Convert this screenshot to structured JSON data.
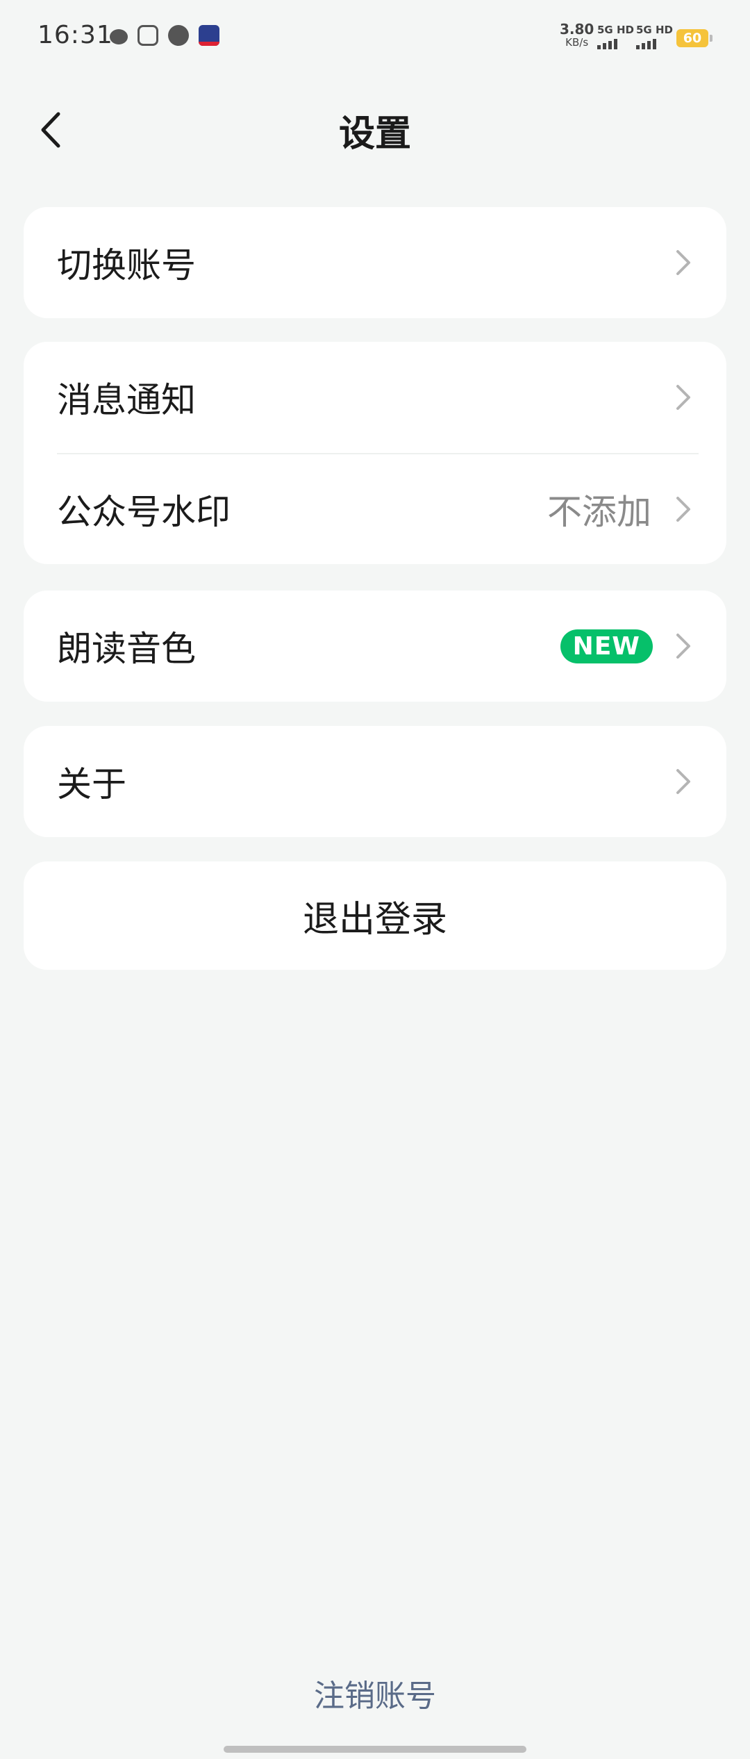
{
  "status_bar": {
    "time": "16:31",
    "net_speed_value": "3.80",
    "net_speed_unit": "KB/s",
    "sim1": "5G HD",
    "sim2": "5G HD",
    "battery": "60",
    "icons": [
      "wechat-icon",
      "scan-app-icon",
      "message-bubble-icon",
      "app-icon"
    ]
  },
  "header": {
    "title": "设置"
  },
  "groups": [
    {
      "items": [
        {
          "label": "切换账号"
        }
      ]
    },
    {
      "items": [
        {
          "label": "消息通知"
        },
        {
          "label": "公众号水印",
          "value": "不添加"
        }
      ]
    },
    {
      "items": [
        {
          "label": "朗读音色",
          "badge": "NEW"
        }
      ]
    },
    {
      "items": [
        {
          "label": "关于"
        }
      ]
    }
  ],
  "logout_label": "退出登录",
  "cancel_account_label": "注销账号",
  "colors": {
    "background": "#f4f6f5",
    "badge": "#06c06a",
    "link": "#5a6b88"
  }
}
